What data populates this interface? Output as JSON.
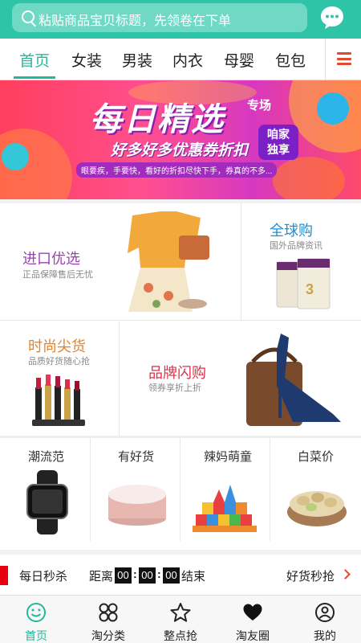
{
  "search": {
    "placeholder": "粘贴商品宝贝标题，先领卷在下单",
    "icon": "search-icon"
  },
  "header": {
    "chat_icon": "chat-bubble-icon",
    "colors": {
      "bar": "#2ec4a8",
      "search_box": "#6fd9c5"
    }
  },
  "tabs": [
    {
      "label": "首页",
      "active": true
    },
    {
      "label": "女装",
      "active": false
    },
    {
      "label": "男装",
      "active": false
    },
    {
      "label": "内衣",
      "active": false
    },
    {
      "label": "母婴",
      "active": false
    },
    {
      "label": "包包",
      "active": false
    }
  ],
  "tabs_menu_icon": "hamburger-menu-icon",
  "banner": {
    "title": "每日精选",
    "title_suffix": "专场",
    "subtitle": "好多好多优惠券折扣",
    "tagline": "眼要疾，手要快，看好的折扣尽快下手，券真的不多...",
    "badge_line1": "咱家",
    "badge_line2": "独享"
  },
  "grid": {
    "import": {
      "title": "进口优选",
      "subtitle": "正品保障售后无忧",
      "color": "#9b3fb5"
    },
    "global": {
      "title": "全球购",
      "subtitle": "国外品牌资讯",
      "color": "#1f8fd1"
    },
    "fashion": {
      "title": "时尚尖货",
      "subtitle": "品质好货随心抢",
      "color": "#e8832a"
    },
    "brand": {
      "title": "品牌闪购",
      "subtitle": "领券享折上折",
      "color": "#d9304a"
    },
    "small": [
      {
        "title": "潮流范"
      },
      {
        "title": "有好货"
      },
      {
        "title": "辣妈萌童"
      },
      {
        "title": "白菜价"
      }
    ]
  },
  "seckill": {
    "title": "每日秒杀",
    "distance_label": "距离",
    "hours": "00",
    "minutes": "00",
    "seconds": "00",
    "end_label": "结束",
    "more_label": "好货秒抢",
    "accent": "#e60012"
  },
  "bottom_nav": [
    {
      "label": "首页",
      "icon": "smile-icon",
      "active": true
    },
    {
      "label": "淘分类",
      "icon": "category-grid-icon",
      "active": false
    },
    {
      "label": "整点抢",
      "icon": "star-icon",
      "active": false
    },
    {
      "label": "淘友圈",
      "icon": "heart-icon",
      "active": false
    },
    {
      "label": "我的",
      "icon": "user-icon",
      "active": false
    }
  ],
  "accent_color": "#24b89b"
}
